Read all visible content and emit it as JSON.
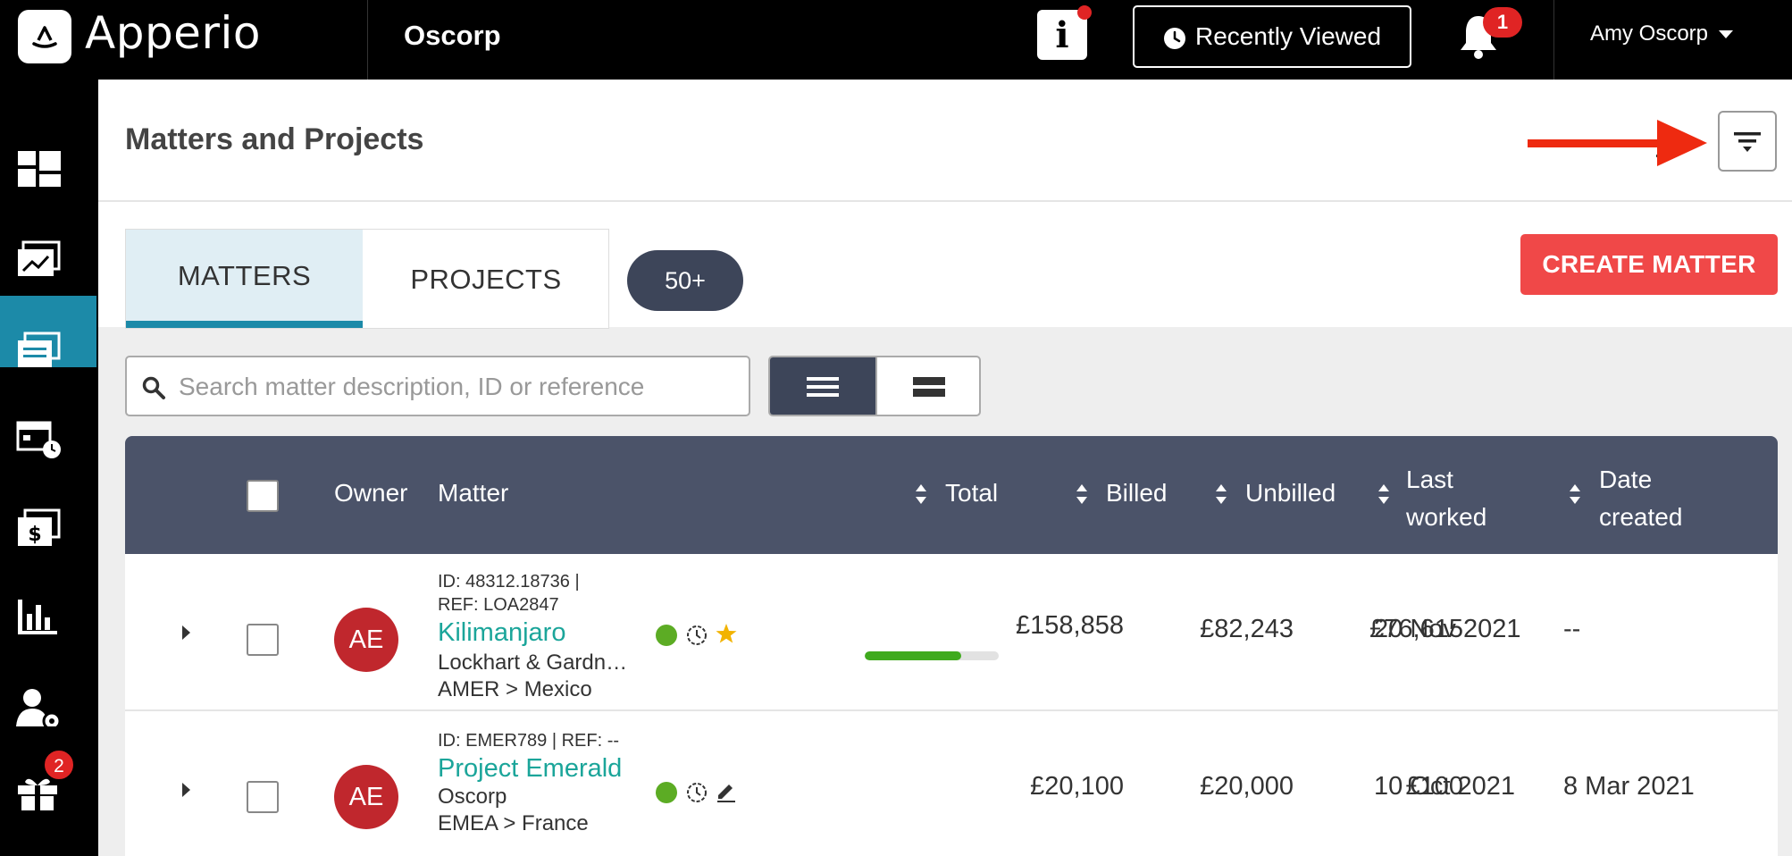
{
  "header": {
    "brand": "Apperio",
    "org": "Oscorp",
    "recently_viewed_label": "Recently Viewed",
    "notification_count": "1",
    "user_name": "Amy Oscorp"
  },
  "sidebar": {
    "items": [
      {
        "icon": "dashboard-icon"
      },
      {
        "icon": "analytics-icon"
      },
      {
        "icon": "matters-icon",
        "active": true
      },
      {
        "icon": "timekeeping-icon"
      },
      {
        "icon": "invoices-icon"
      },
      {
        "icon": "reports-icon"
      },
      {
        "icon": "user-settings-icon"
      },
      {
        "icon": "gift-icon",
        "badge": "2"
      }
    ]
  },
  "page": {
    "title": "Matters and Projects"
  },
  "tabs": {
    "matters": "MATTERS",
    "projects": "PROJECTS",
    "count": "50+",
    "create_label": "CREATE MATTER"
  },
  "search": {
    "placeholder": "Search matter description, ID or reference"
  },
  "table": {
    "headers": {
      "owner": "Owner",
      "matter": "Matter",
      "total": "Total",
      "billed": "Billed",
      "unbilled": "Unbilled",
      "last_worked_1": "Last",
      "last_worked_2": "worked",
      "date_created_1": "Date",
      "date_created_2": "created"
    },
    "rows": [
      {
        "owner_initials": "AE",
        "id_line_1": "ID: 48312.18736  |",
        "id_line_2": "REF: LOA2847",
        "name": "Kilimanjaro",
        "client": "Lockhart & Gardn…",
        "region": "AMER > Mexico",
        "total": "£158,858",
        "progress": 0.72,
        "billed": "£82,243",
        "unbilled": "£76,615",
        "last_worked": "20 Nov 2021",
        "date_created": "--"
      },
      {
        "owner_initials": "AE",
        "id_line_1": "ID: EMER789  |  REF: --",
        "name": "Project Emerald",
        "client": "Oscorp",
        "region": "EMEA > France",
        "total": "£20,100",
        "billed": "£20,000",
        "unbilled": "£100",
        "last_worked": "10 Oct 2021",
        "date_created": "8 Mar 2021"
      }
    ]
  },
  "colors": {
    "accent": "#1c8aa8",
    "create_button": "#f04848",
    "table_header": "#4b5369",
    "link": "#1ba59a",
    "avatar": "#c0272d",
    "status_green": "#5cac24",
    "annotation_arrow": "#ee2a10"
  }
}
